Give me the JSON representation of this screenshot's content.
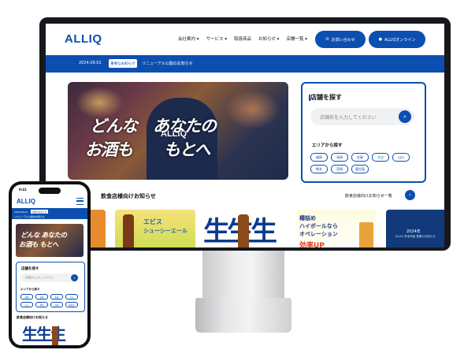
{
  "brand": {
    "logo": "ALLIQ",
    "accent": "#0d4fb0"
  },
  "desktop": {
    "nav": [
      "会社案内 ▾",
      "サービス ▾",
      "取扱商品",
      "お知らせ ▾",
      "店舗一覧 ▾"
    ],
    "contact_button": "お問い合わせ",
    "online_button": "ALLIQオンライン",
    "news": {
      "date": "2024.09.01",
      "tag": "重要なお知らせ",
      "text": "リニューアル公開のお知らせ"
    },
    "hero": {
      "line1": "どんな　あなたの",
      "line2": "お酒も　　もとへ",
      "shirt": "ALLIQ"
    },
    "store_search": {
      "title": "店舗を探す",
      "placeholder": "店舗名を入力してください",
      "search_icon": "search-icon",
      "area_label": "エリアから探す",
      "areas": [
        "福岡",
        "長崎",
        "佐賀",
        "大分",
        "山口",
        "熊本",
        "宮崎",
        "鹿児島"
      ]
    },
    "section": {
      "title": "飲食店様向けお知らせ",
      "link": "飲食店様向けお知らせ一覧"
    },
    "cards": {
      "c2_line1": "エビス",
      "c2_line2": "シューシーエール",
      "c3_text": "生生生",
      "c4_line1": "樽詰め",
      "c4_line2": "ハイボールなら",
      "c4_line3": "オペレーション",
      "c4_line4": "効率UP",
      "c5_year": "2024年",
      "c5_caption": "ALLIQ 年末年始 営業のお知らせ"
    }
  },
  "phone": {
    "time": "9:41",
    "logo": "ALLIQ",
    "news": {
      "date": "2024.09.01",
      "tag": "重要なお知らせ",
      "text": "リニューアル公開のお知らせ"
    },
    "hero": {
      "line1": "どんな あなたの",
      "line2": "お酒も もとへ"
    },
    "store_search": {
      "title": "店舗を探す",
      "placeholder": "店舗名を入力してください",
      "area_label": "エリアから探す",
      "areas": [
        "福岡",
        "長崎",
        "佐賀",
        "大分",
        "山口",
        "熊本",
        "宮崎",
        "鹿児島"
      ]
    },
    "section_title": "飲食店様向けお知らせ",
    "image_text": "生生生"
  }
}
